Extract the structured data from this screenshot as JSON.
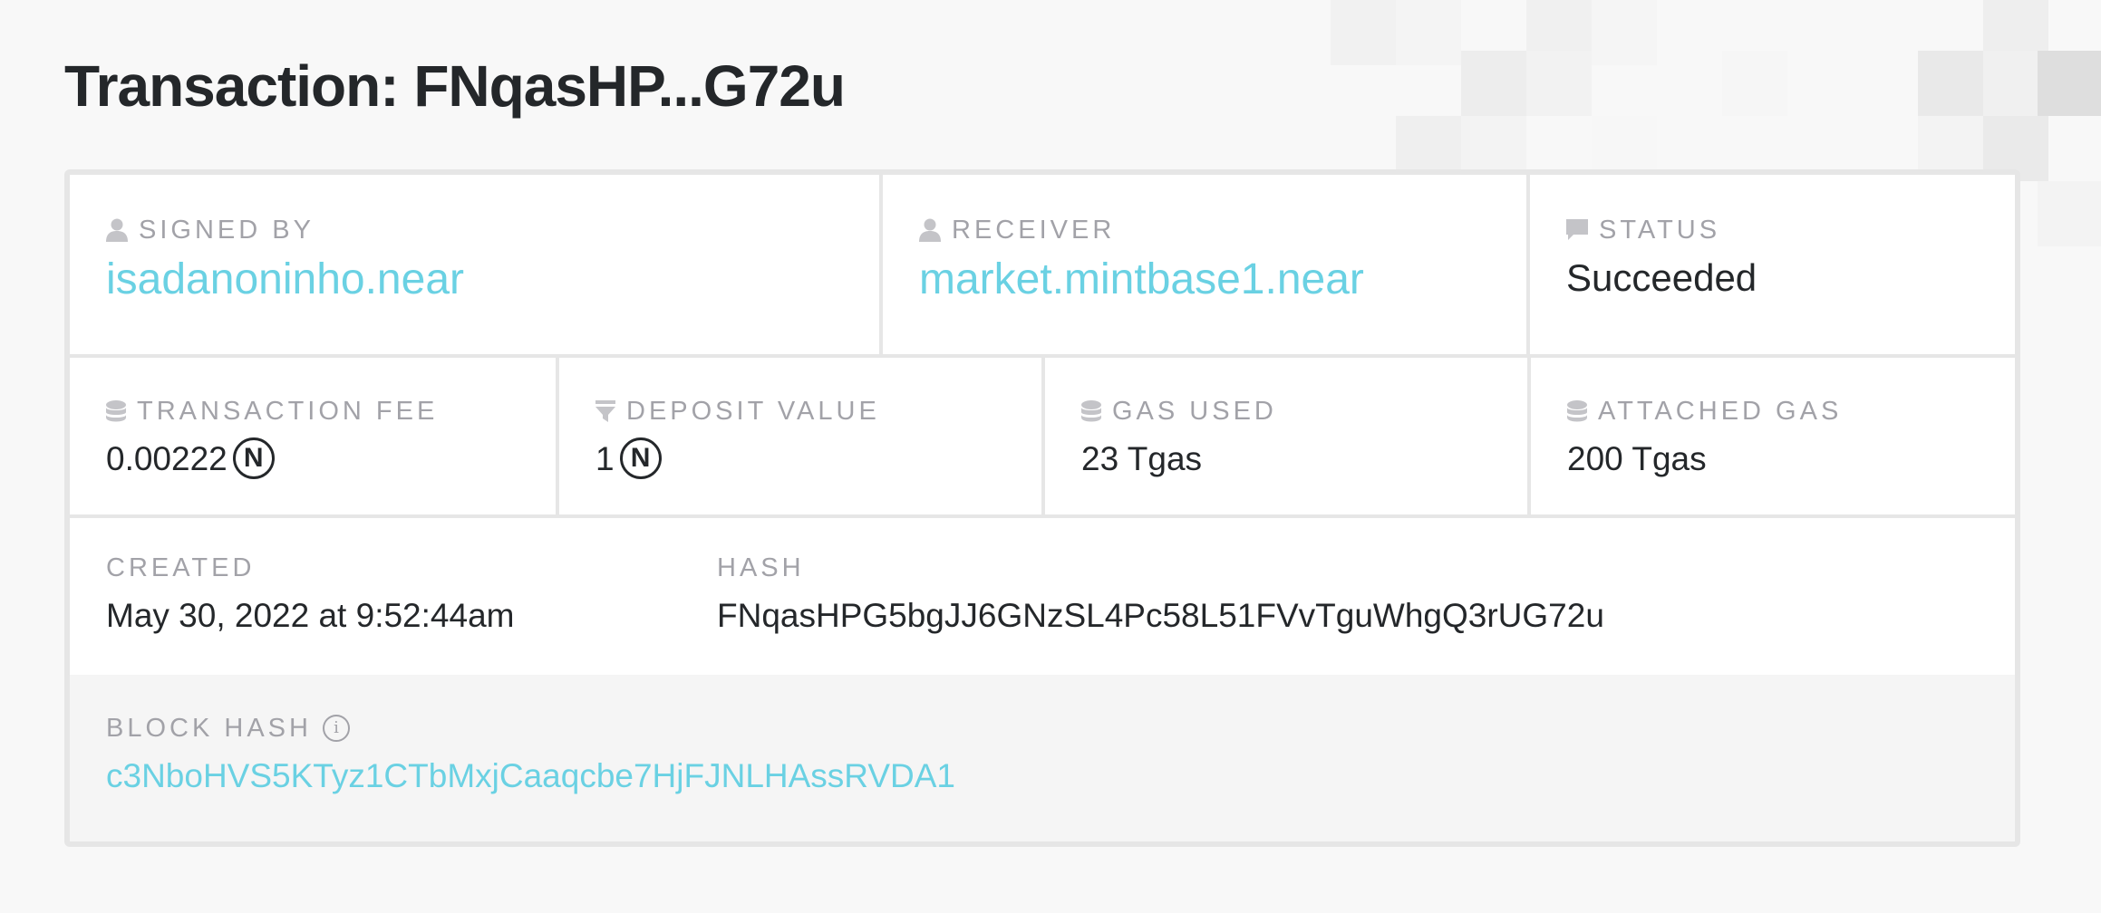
{
  "page_title": "Transaction: FNqasHP...G72u",
  "signed_by": {
    "label": "SIGNED BY",
    "value": "isadanoninho.near"
  },
  "receiver": {
    "label": "RECEIVER",
    "value": "market.mintbase1.near"
  },
  "status": {
    "label": "STATUS",
    "value": "Succeeded"
  },
  "transaction_fee": {
    "label": "TRANSACTION FEE",
    "value": "0.00222",
    "unit": "N"
  },
  "deposit_value": {
    "label": "DEPOSIT VALUE",
    "value": "1",
    "unit": "N"
  },
  "gas_used": {
    "label": "GAS USED",
    "value": "23 Tgas"
  },
  "attached_gas": {
    "label": "ATTACHED GAS",
    "value": "200 Tgas"
  },
  "created": {
    "label": "CREATED",
    "value": "May 30, 2022 at 9:52:44am"
  },
  "hash": {
    "label": "HASH",
    "value": "FNqasHPG5bgJJ6GNzSL4Pc58L51FVvTguWhgQ3rUG72u"
  },
  "block_hash": {
    "label": "BLOCK HASH",
    "info_icon": "i",
    "value": "c3NboHVS5KTyz1CTbMxjCaaqcbe7HjFJNLHAssRVDA1"
  },
  "icons": {
    "signed_by": "user-icon",
    "receiver": "user-icon",
    "status": "speech-bubble-icon",
    "transaction_fee": "database-icon",
    "deposit_value": "filter-icon",
    "gas_used": "database-icon",
    "attached_gas": "database-icon",
    "block_hash": "info-icon"
  },
  "colors": {
    "link": "#6ad1e3",
    "label": "#a2a2a8",
    "text": "#24272a",
    "border": "#e6e6e6"
  }
}
